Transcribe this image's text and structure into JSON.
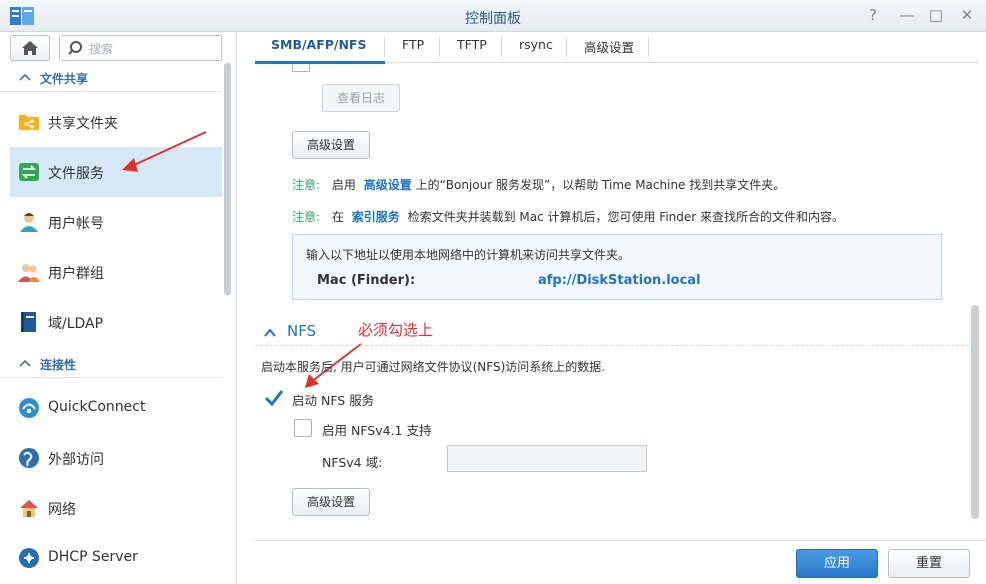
{
  "window": {
    "title": "控制面板",
    "help_glyph": "?",
    "minimize_glyph": "—",
    "maximize_glyph": "□",
    "close_glyph": "✕"
  },
  "sidebar": {
    "search_placeholder": "搜索",
    "sections": [
      {
        "label": "文件共享",
        "items": [
          {
            "label": "共享文件夹",
            "icon": "shared-folder-icon"
          },
          {
            "label": "文件服务",
            "icon": "file-services-icon",
            "active": true
          },
          {
            "label": "用户帐号",
            "icon": "user-icon"
          },
          {
            "label": "用户群组",
            "icon": "group-icon"
          },
          {
            "label": "域/LDAP",
            "icon": "domain-ldap-icon"
          }
        ]
      },
      {
        "label": "连接性",
        "items": [
          {
            "label": "QuickConnect",
            "icon": "quickconnect-icon"
          },
          {
            "label": "外部访问",
            "icon": "external-access-icon"
          },
          {
            "label": "网络",
            "icon": "network-icon"
          },
          {
            "label": "DHCP Server",
            "icon": "dhcp-server-icon"
          }
        ]
      }
    ]
  },
  "tabs": [
    {
      "label": "SMB/AFP/NFS",
      "active": true
    },
    {
      "label": "FTP"
    },
    {
      "label": "TFTP"
    },
    {
      "label": "rsync"
    },
    {
      "label": "高级设置"
    }
  ],
  "afp": {
    "view_log_button": "查看日志",
    "advanced_button": "高级设置",
    "note1": {
      "tag": "注意:",
      "pre": "启用",
      "link": "高级设置",
      "post": "上的“Bonjour 服务发现”，以帮助 Time Machine 找到共享文件夹。"
    },
    "note2": {
      "tag": "注意:",
      "pre": "在",
      "link": "索引服务",
      "post": "检索文件夹并装载到 Mac 计算机后，您可使用 Finder 来查找所合的文件和内容。"
    },
    "info_text": "输入以下地址以使用本地网络中的计算机来访问共享文件夹。",
    "mac_label": "Mac (Finder):",
    "mac_address": "afp://DiskStation.local"
  },
  "nfs": {
    "section_title": "NFS",
    "annotation": "必须勾选上",
    "description": "启动本服务后, 用户可通过网络文件协议(NFS)访问系统上的数据.",
    "enable_label": "启动 NFS 服务",
    "enable_checked": true,
    "nfsv41_label": "启用 NFSv4.1 支持",
    "nfsv41_checked": false,
    "nfsv4_domain_label": "NFSv4 域:",
    "nfsv4_domain_value": "",
    "advanced_button": "高级设置"
  },
  "footer": {
    "apply": "应用",
    "reset": "重置"
  },
  "colors": {
    "accent": "#1f74c5",
    "note_tag": "#36a36b",
    "annotation": "#e03030",
    "active_nav": "#d6e8f7"
  }
}
